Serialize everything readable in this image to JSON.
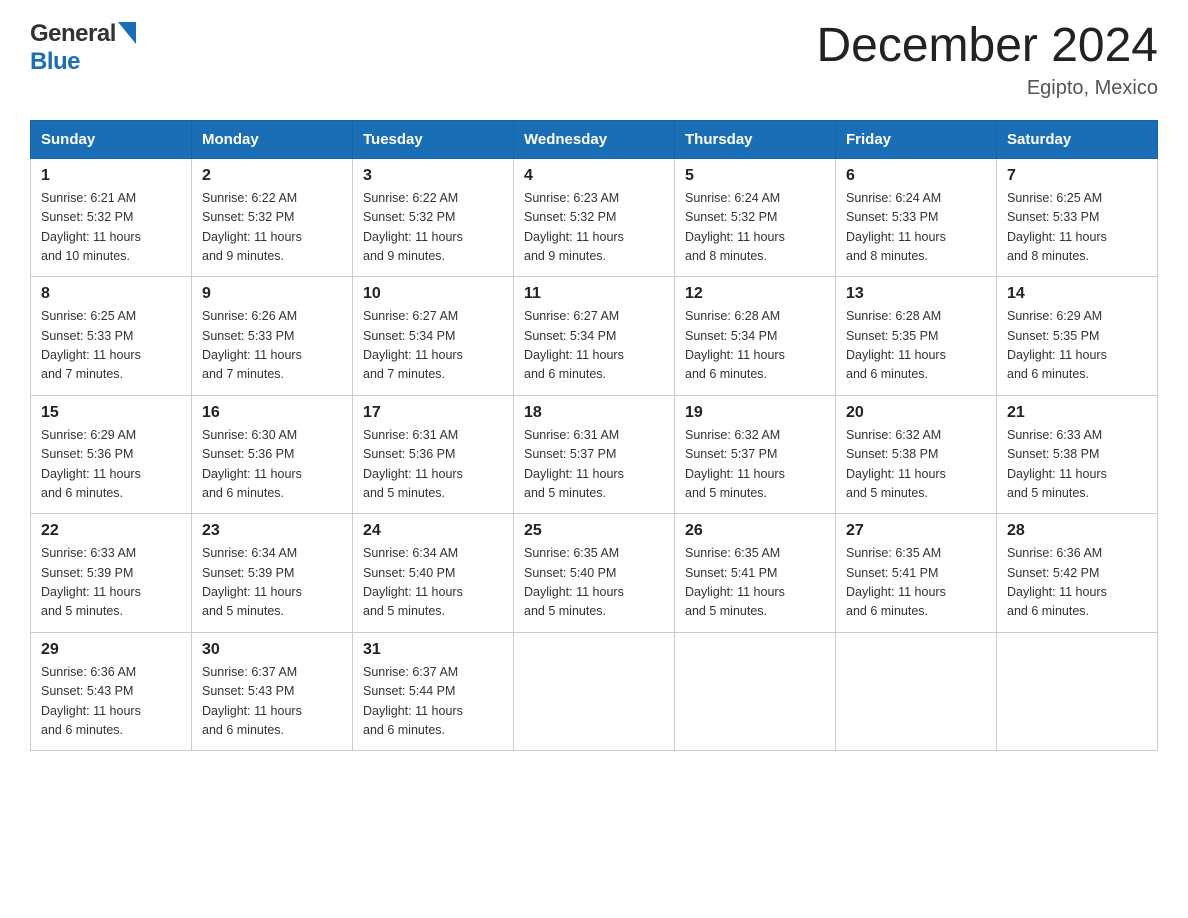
{
  "header": {
    "logo_general": "General",
    "logo_blue": "Blue",
    "month_title": "December 2024",
    "location": "Egipto, Mexico"
  },
  "weekdays": [
    "Sunday",
    "Monday",
    "Tuesday",
    "Wednesday",
    "Thursday",
    "Friday",
    "Saturday"
  ],
  "weeks": [
    [
      {
        "day": "1",
        "sunrise": "6:21 AM",
        "sunset": "5:32 PM",
        "daylight": "11 hours and 10 minutes."
      },
      {
        "day": "2",
        "sunrise": "6:22 AM",
        "sunset": "5:32 PM",
        "daylight": "11 hours and 9 minutes."
      },
      {
        "day": "3",
        "sunrise": "6:22 AM",
        "sunset": "5:32 PM",
        "daylight": "11 hours and 9 minutes."
      },
      {
        "day": "4",
        "sunrise": "6:23 AM",
        "sunset": "5:32 PM",
        "daylight": "11 hours and 9 minutes."
      },
      {
        "day": "5",
        "sunrise": "6:24 AM",
        "sunset": "5:32 PM",
        "daylight": "11 hours and 8 minutes."
      },
      {
        "day": "6",
        "sunrise": "6:24 AM",
        "sunset": "5:33 PM",
        "daylight": "11 hours and 8 minutes."
      },
      {
        "day": "7",
        "sunrise": "6:25 AM",
        "sunset": "5:33 PM",
        "daylight": "11 hours and 8 minutes."
      }
    ],
    [
      {
        "day": "8",
        "sunrise": "6:25 AM",
        "sunset": "5:33 PM",
        "daylight": "11 hours and 7 minutes."
      },
      {
        "day": "9",
        "sunrise": "6:26 AM",
        "sunset": "5:33 PM",
        "daylight": "11 hours and 7 minutes."
      },
      {
        "day": "10",
        "sunrise": "6:27 AM",
        "sunset": "5:34 PM",
        "daylight": "11 hours and 7 minutes."
      },
      {
        "day": "11",
        "sunrise": "6:27 AM",
        "sunset": "5:34 PM",
        "daylight": "11 hours and 6 minutes."
      },
      {
        "day": "12",
        "sunrise": "6:28 AM",
        "sunset": "5:34 PM",
        "daylight": "11 hours and 6 minutes."
      },
      {
        "day": "13",
        "sunrise": "6:28 AM",
        "sunset": "5:35 PM",
        "daylight": "11 hours and 6 minutes."
      },
      {
        "day": "14",
        "sunrise": "6:29 AM",
        "sunset": "5:35 PM",
        "daylight": "11 hours and 6 minutes."
      }
    ],
    [
      {
        "day": "15",
        "sunrise": "6:29 AM",
        "sunset": "5:36 PM",
        "daylight": "11 hours and 6 minutes."
      },
      {
        "day": "16",
        "sunrise": "6:30 AM",
        "sunset": "5:36 PM",
        "daylight": "11 hours and 6 minutes."
      },
      {
        "day": "17",
        "sunrise": "6:31 AM",
        "sunset": "5:36 PM",
        "daylight": "11 hours and 5 minutes."
      },
      {
        "day": "18",
        "sunrise": "6:31 AM",
        "sunset": "5:37 PM",
        "daylight": "11 hours and 5 minutes."
      },
      {
        "day": "19",
        "sunrise": "6:32 AM",
        "sunset": "5:37 PM",
        "daylight": "11 hours and 5 minutes."
      },
      {
        "day": "20",
        "sunrise": "6:32 AM",
        "sunset": "5:38 PM",
        "daylight": "11 hours and 5 minutes."
      },
      {
        "day": "21",
        "sunrise": "6:33 AM",
        "sunset": "5:38 PM",
        "daylight": "11 hours and 5 minutes."
      }
    ],
    [
      {
        "day": "22",
        "sunrise": "6:33 AM",
        "sunset": "5:39 PM",
        "daylight": "11 hours and 5 minutes."
      },
      {
        "day": "23",
        "sunrise": "6:34 AM",
        "sunset": "5:39 PM",
        "daylight": "11 hours and 5 minutes."
      },
      {
        "day": "24",
        "sunrise": "6:34 AM",
        "sunset": "5:40 PM",
        "daylight": "11 hours and 5 minutes."
      },
      {
        "day": "25",
        "sunrise": "6:35 AM",
        "sunset": "5:40 PM",
        "daylight": "11 hours and 5 minutes."
      },
      {
        "day": "26",
        "sunrise": "6:35 AM",
        "sunset": "5:41 PM",
        "daylight": "11 hours and 5 minutes."
      },
      {
        "day": "27",
        "sunrise": "6:35 AM",
        "sunset": "5:41 PM",
        "daylight": "11 hours and 6 minutes."
      },
      {
        "day": "28",
        "sunrise": "6:36 AM",
        "sunset": "5:42 PM",
        "daylight": "11 hours and 6 minutes."
      }
    ],
    [
      {
        "day": "29",
        "sunrise": "6:36 AM",
        "sunset": "5:43 PM",
        "daylight": "11 hours and 6 minutes."
      },
      {
        "day": "30",
        "sunrise": "6:37 AM",
        "sunset": "5:43 PM",
        "daylight": "11 hours and 6 minutes."
      },
      {
        "day": "31",
        "sunrise": "6:37 AM",
        "sunset": "5:44 PM",
        "daylight": "11 hours and 6 minutes."
      },
      null,
      null,
      null,
      null
    ]
  ],
  "labels": {
    "sunrise": "Sunrise:",
    "sunset": "Sunset:",
    "daylight": "Daylight:"
  }
}
